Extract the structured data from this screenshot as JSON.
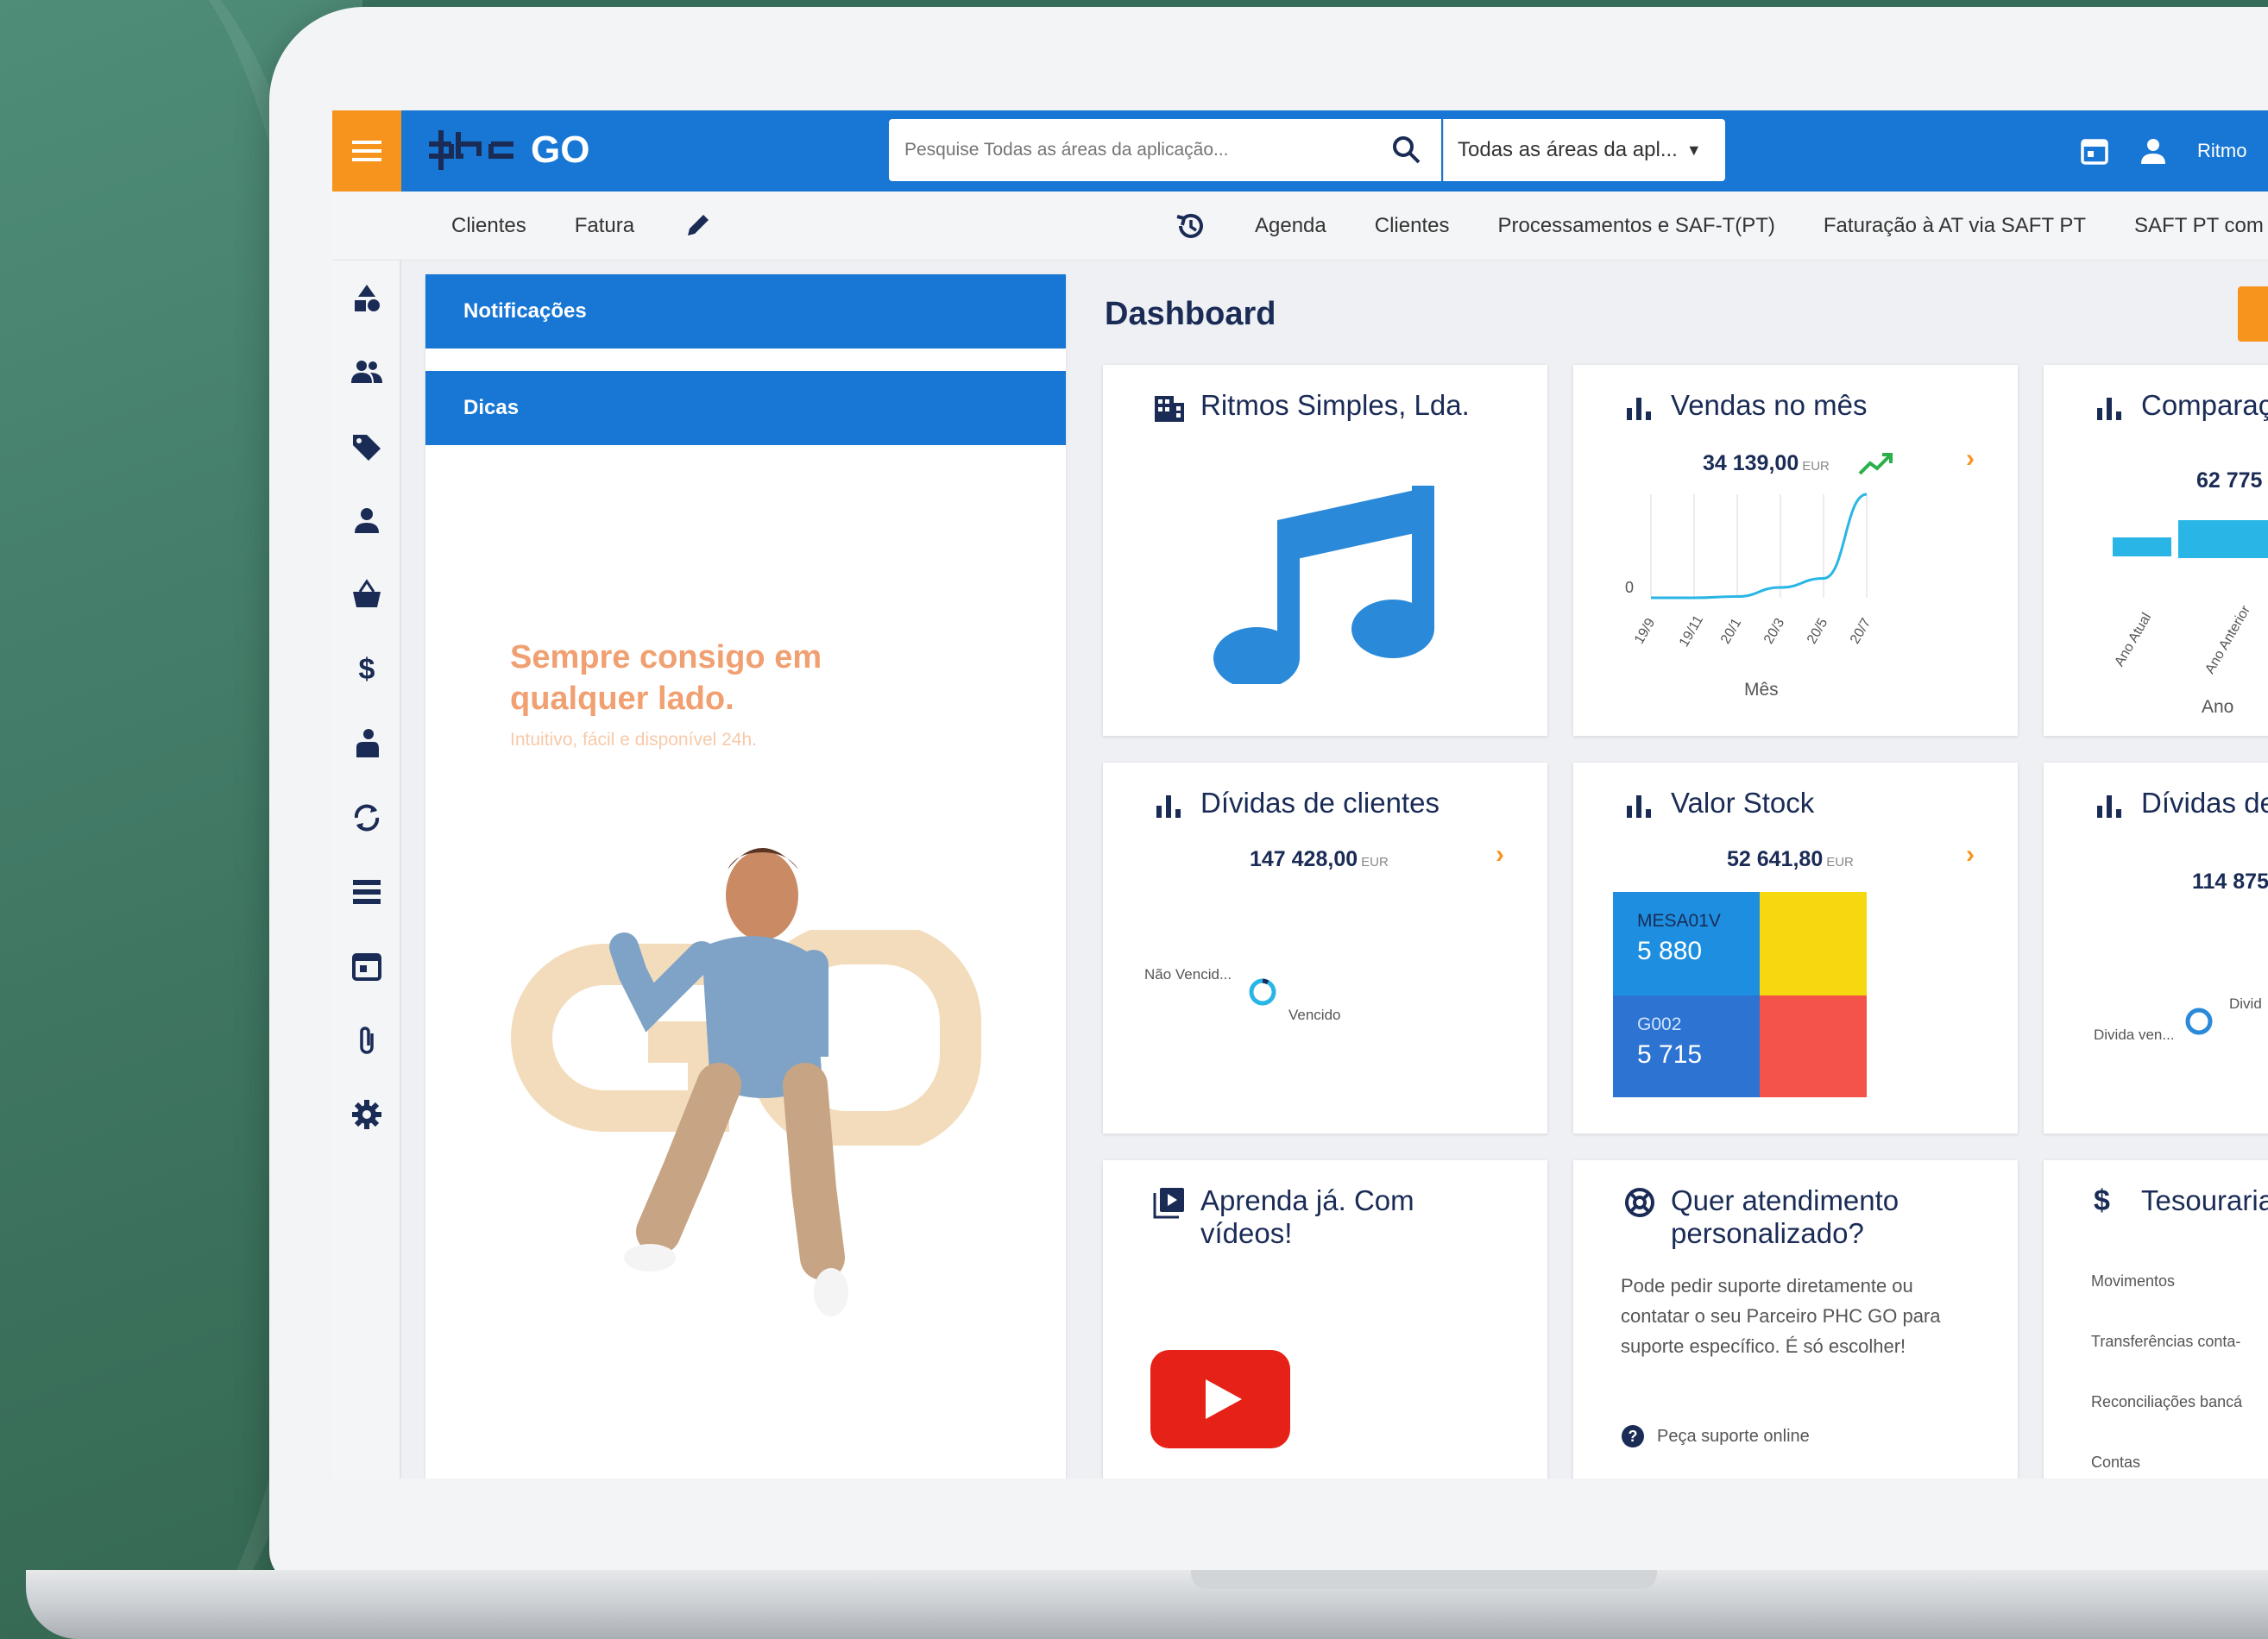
{
  "topbar": {
    "logo_mark": "phc",
    "logo_text": "GO",
    "search_placeholder": "Pesquise Todas as áreas da aplicação...",
    "search_scope": "Todas as áreas da apl...",
    "user_name": "Ritmo"
  },
  "nav": {
    "left": [
      "Clientes",
      "Fatura"
    ],
    "right": [
      "Agenda",
      "Clientes",
      "Processamentos e SAF-T(PT)",
      "Faturação à AT via SAFT PT",
      "SAFT PT com"
    ]
  },
  "sidebar": {
    "icons": [
      "shapes-icon",
      "people-icon",
      "tag-icon",
      "person-icon",
      "basket-icon",
      "dollar-icon",
      "hand-coin-icon",
      "sync-icon",
      "list-icon",
      "calendar-icon",
      "paperclip-icon",
      "gear-icon"
    ]
  },
  "panel": {
    "tab_notifications": "Notificações",
    "tab_tips": "Dicas",
    "promo_title": "Sempre consigo em qualquer lado.",
    "promo_subtitle": "Intuitivo, fácil e disponível 24h."
  },
  "dashboard": {
    "title": "Dashboard",
    "company": {
      "title": "Ritmos Simples, Lda."
    },
    "sales": {
      "title": "Vendas no mês",
      "value": "34 139,00",
      "unit": "EUR",
      "xlabel": "Mês",
      "y_tick": "0",
      "x_ticks": [
        "19/9",
        "19/11",
        "20/1",
        "20/3",
        "20/5",
        "20/7"
      ]
    },
    "compare": {
      "title": "Comparação rentabilidade",
      "value": "62 775",
      "xlabel": "Ano",
      "x_ticks": [
        "Ano Atual",
        "Ano Anterior"
      ]
    },
    "client_debts": {
      "title": "Dívidas de clientes",
      "value": "147 428,00",
      "unit": "EUR",
      "label_a": "Não Vencid...",
      "label_b": "Vencido"
    },
    "stock": {
      "title": "Valor Stock",
      "value": "52 641,80",
      "unit": "EUR",
      "tiles": [
        {
          "name": "MESA01V",
          "value": "5 880",
          "color": "#1e8fe0"
        },
        {
          "name": "",
          "value": "",
          "color": "#f5d80f"
        },
        {
          "name": "G002",
          "value": "5 715",
          "color": "#2c73d2"
        },
        {
          "name": "",
          "value": "",
          "color": "#f4534a"
        }
      ]
    },
    "supplier_debts": {
      "title": "Dívidas de fornecedores",
      "value": "114 875",
      "label_a": "Divida ven...",
      "label_b": "Divid"
    },
    "videos": {
      "title": "Aprenda já. Com vídeos!"
    },
    "support": {
      "title": "Quer atendimento personalizado?",
      "text": "Pode pedir suporte diretamente ou contatar o seu Parceiro PHC GO para suporte específico. É só escolher!",
      "link": "Peça suporte online"
    },
    "treasury": {
      "title": "Tesouraria",
      "items": [
        "Movimentos",
        "Transferências conta-",
        "Reconciliações bancá",
        "Contas"
      ]
    }
  },
  "colors": {
    "brand_blue": "#1877d4",
    "accent_orange": "#f7941d",
    "navy": "#1a2b56",
    "chart_cyan": "#29b6e6",
    "youtube_red": "#e62117"
  },
  "chart_data": [
    {
      "type": "line",
      "title": "Vendas no mês",
      "xlabel": "Mês",
      "categories": [
        "19/9",
        "19/11",
        "20/1",
        "20/3",
        "20/5",
        "20/7"
      ],
      "values": [
        0,
        0,
        100,
        800,
        1500,
        8000
      ]
    },
    {
      "type": "bar",
      "title": "Comparação rentabilidade",
      "xlabel": "Ano",
      "categories": [
        "Ano Atual",
        "Ano Anterior"
      ],
      "values": [
        40,
        60
      ]
    }
  ]
}
